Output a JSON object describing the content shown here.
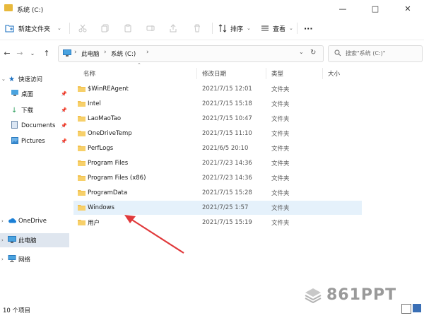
{
  "window": {
    "title": "系统 (C:)"
  },
  "toolbar": {
    "new_folder_label": "新建文件夹",
    "sort_label": "排序",
    "view_label": "查看",
    "more_label": "···"
  },
  "address": {
    "crumbs": [
      "此电脑",
      "系统 (C:)"
    ],
    "search_placeholder": "搜索\"系统 (C:)\""
  },
  "sidebar": {
    "items": [
      {
        "label": "快速访问",
        "icon": "star-icon"
      },
      {
        "label": "桌面",
        "icon": "desktop-icon"
      },
      {
        "label": "下载",
        "icon": "download-icon"
      },
      {
        "label": "Documents",
        "icon": "document-icon"
      },
      {
        "label": "Pictures",
        "icon": "picture-icon"
      },
      {
        "label": "OneDrive",
        "icon": "cloud-icon"
      },
      {
        "label": "此电脑",
        "icon": "computer-icon"
      },
      {
        "label": "网络",
        "icon": "network-icon"
      }
    ]
  },
  "columns": {
    "name": "名称",
    "date": "修改日期",
    "type": "类型",
    "size": "大小"
  },
  "files": [
    {
      "name": "$WinREAgent",
      "date": "2021/7/15 12:01",
      "type": "文件夹"
    },
    {
      "name": "Intel",
      "date": "2021/7/15 15:18",
      "type": "文件夹"
    },
    {
      "name": "LaoMaoTao",
      "date": "2021/7/15 10:47",
      "type": "文件夹"
    },
    {
      "name": "OneDriveTemp",
      "date": "2021/7/15 11:10",
      "type": "文件夹"
    },
    {
      "name": "PerfLogs",
      "date": "2021/6/5 20:10",
      "type": "文件夹"
    },
    {
      "name": "Program Files",
      "date": "2021/7/23 14:36",
      "type": "文件夹"
    },
    {
      "name": "Program Files (x86)",
      "date": "2021/7/23 14:36",
      "type": "文件夹"
    },
    {
      "name": "ProgramData",
      "date": "2021/7/15 15:28",
      "type": "文件夹"
    },
    {
      "name": "Windows",
      "date": "2021/7/25 1:57",
      "type": "文件夹"
    },
    {
      "name": "用户",
      "date": "2021/7/15 15:19",
      "type": "文件夹"
    }
  ],
  "status": {
    "count": "10 个项目"
  },
  "watermark": {
    "text": "861PPT"
  },
  "colors": {
    "accent": "#0067c0",
    "folder": "#f2c14e",
    "hover_row": "#e5f1fb",
    "selected_nav": "#dfe6ef",
    "arrow": "#e0393b"
  }
}
